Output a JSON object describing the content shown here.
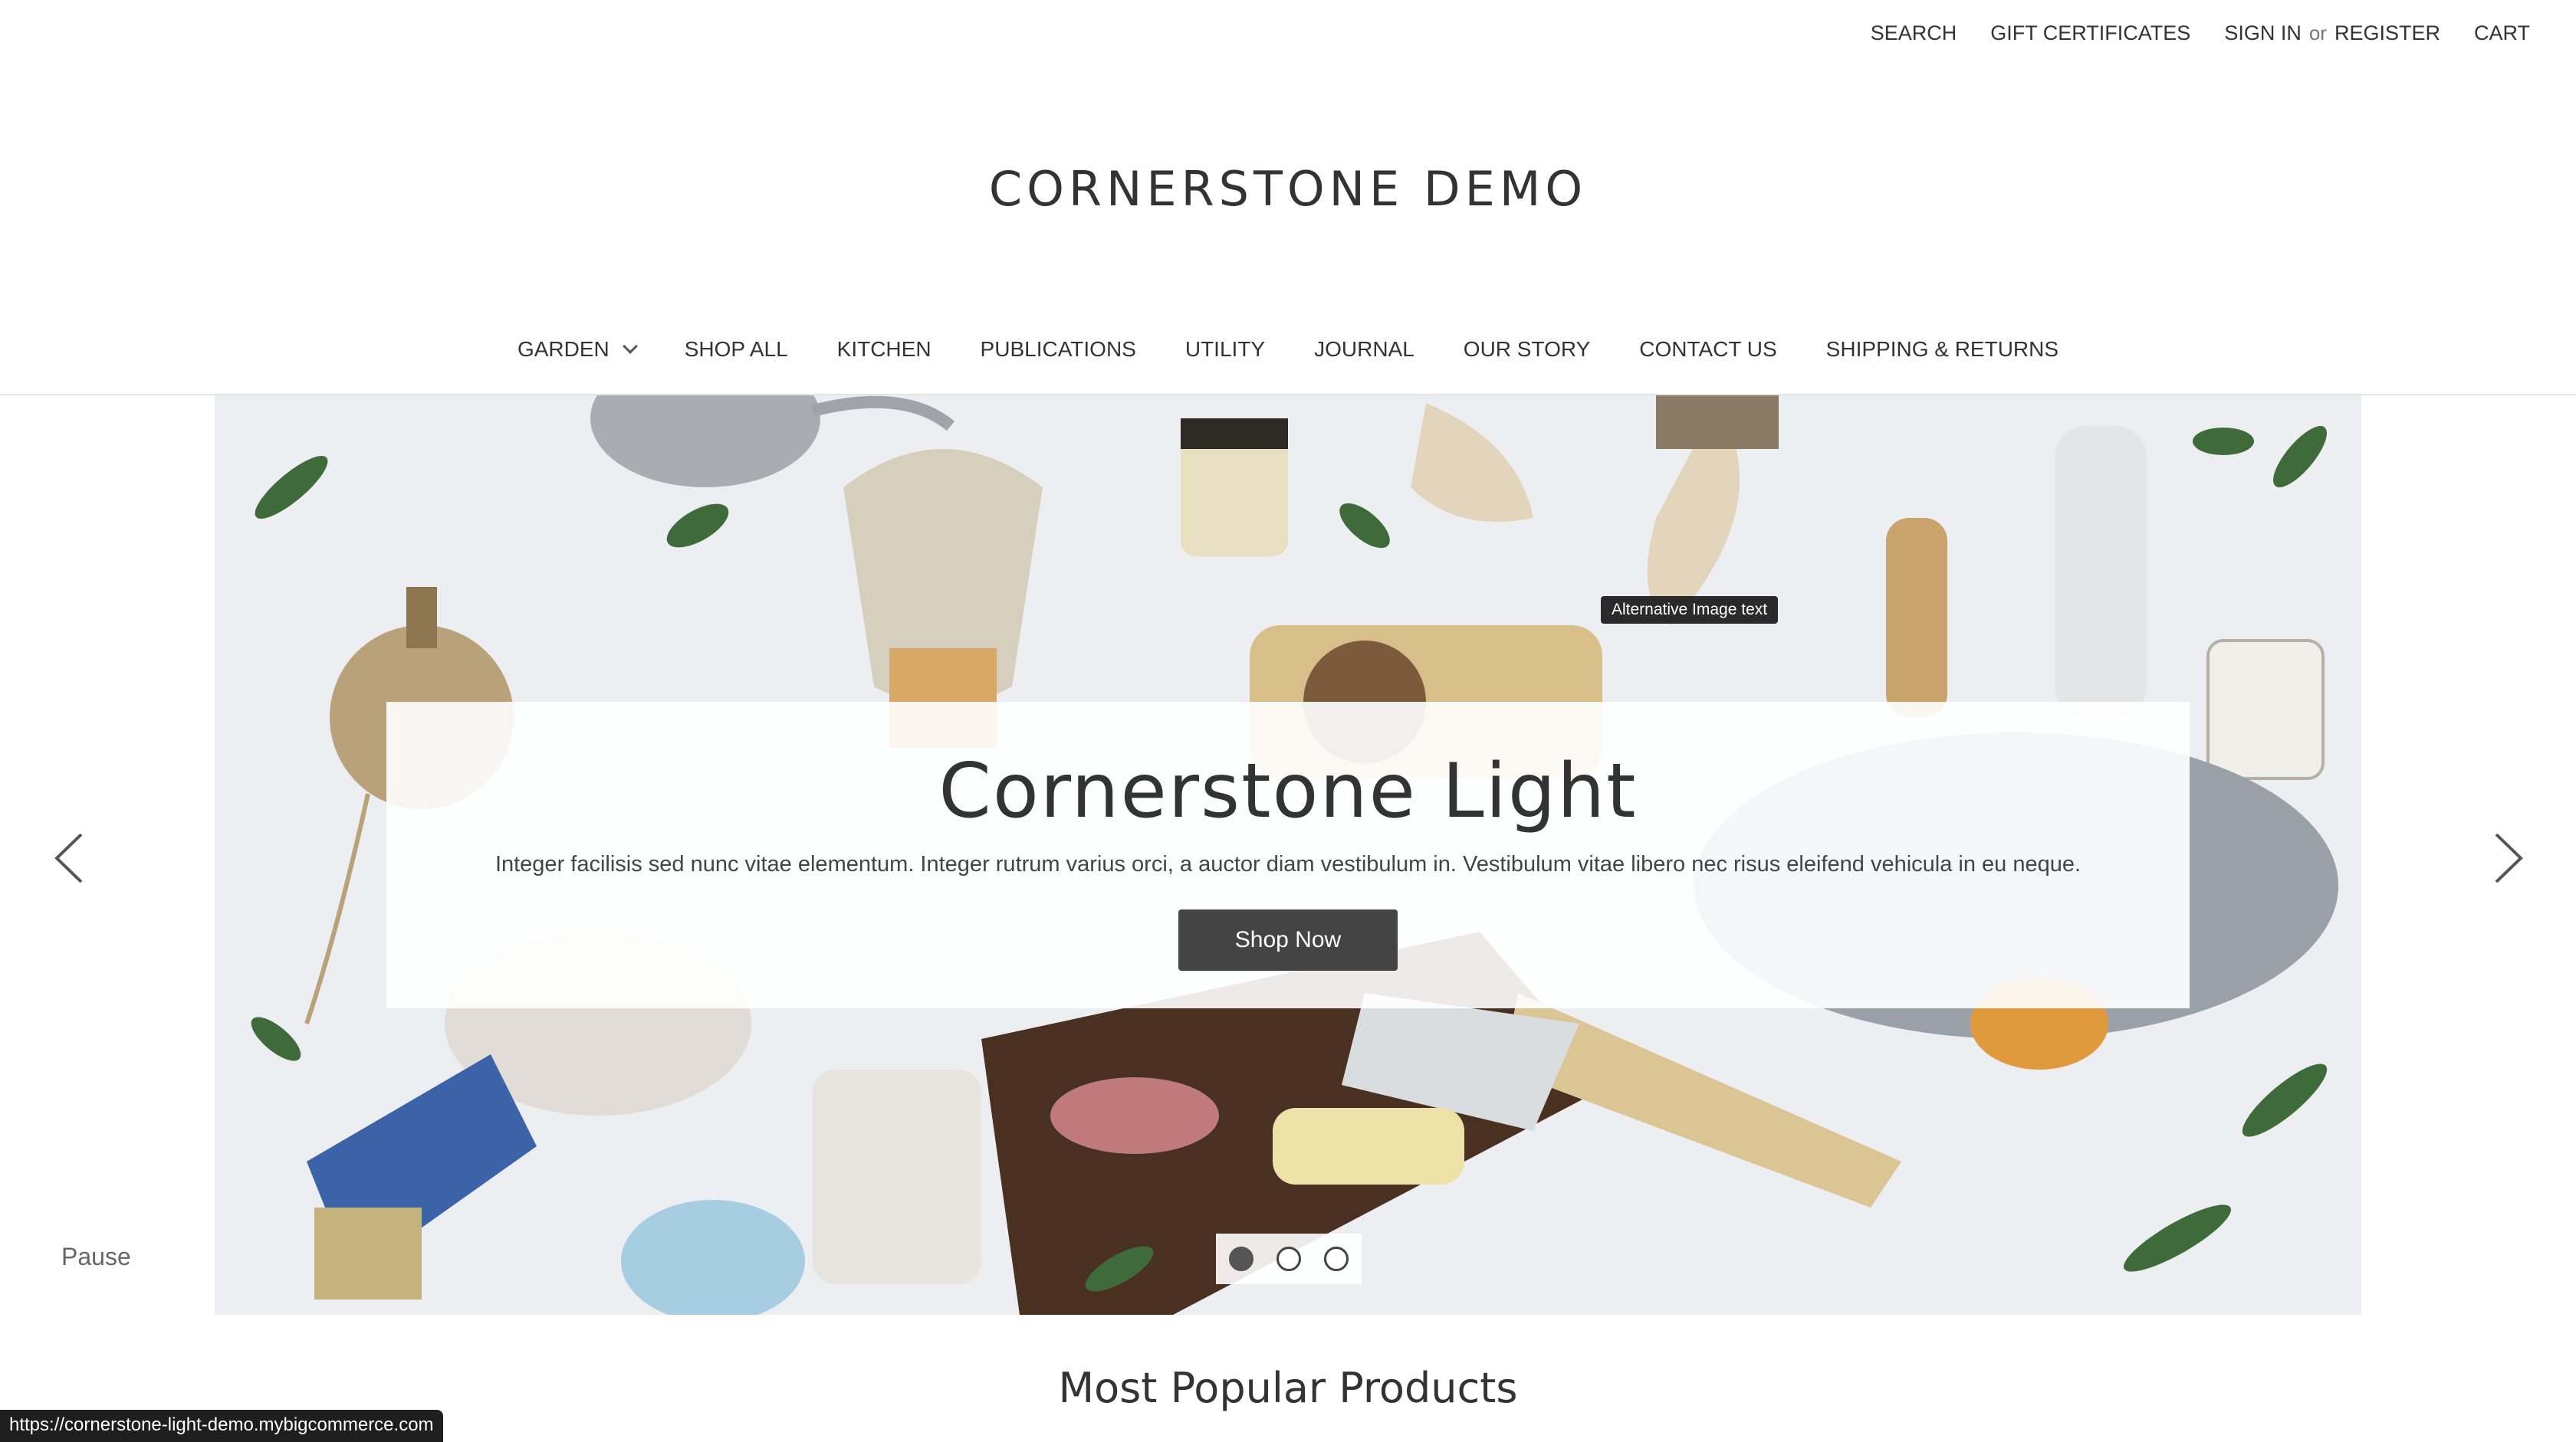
{
  "top_nav": {
    "search": "SEARCH",
    "gift_certificates": "GIFT CERTIFICATES",
    "sign_in": "SIGN IN",
    "or": "or",
    "register": "REGISTER",
    "cart": "CART"
  },
  "logo": "CORNERSTONE DEMO",
  "main_nav": {
    "items": [
      {
        "label": "GARDEN",
        "has_dropdown": true
      },
      {
        "label": "SHOP ALL"
      },
      {
        "label": "KITCHEN"
      },
      {
        "label": "PUBLICATIONS"
      },
      {
        "label": "UTILITY"
      },
      {
        "label": "JOURNAL"
      },
      {
        "label": "OUR STORY"
      },
      {
        "label": "CONTACT US"
      },
      {
        "label": "SHIPPING & RETURNS"
      }
    ]
  },
  "hero": {
    "tooltip": "Alternative Image text",
    "title": "Cornerstone Light",
    "description": "Integer facilisis sed nunc vitae elementum. Integer rutrum varius orci, a auctor diam vestibulum in. Vestibulum vitae libero nec risus eleifend vehicula in eu neque.",
    "cta": "Shop Now",
    "pause": "Pause",
    "slides": 3,
    "active_slide": 1
  },
  "section_heading": "Most Popular Products",
  "status_bar_url": "https://cornerstone-light-demo.mybigcommerce.com",
  "colors": {
    "text": "#333333",
    "button_bg": "#444444",
    "hero_bg": "#eef0f3"
  }
}
